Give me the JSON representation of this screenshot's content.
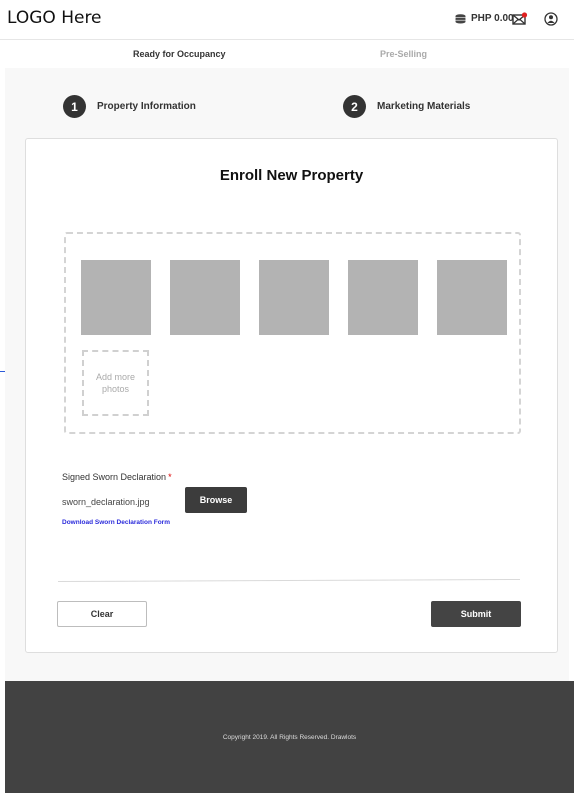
{
  "header": {
    "logo": "LOGO Here",
    "balance": "PHP 0.00",
    "icons": [
      "coins-icon",
      "mail-icon",
      "user-icon"
    ]
  },
  "tabs": [
    {
      "label": "Ready for Occupancy",
      "active": true
    },
    {
      "label": "Pre-Selling",
      "active": false
    }
  ],
  "steps": [
    {
      "number": "1",
      "label": "Property Information"
    },
    {
      "number": "2",
      "label": "Marketing Materials"
    }
  ],
  "form": {
    "title": "Enroll New Property",
    "add_more_label": "Add more photos",
    "sworn_label": "Signed Sworn Declaration",
    "required_mark": "*",
    "file_name": "sworn_declaration.jpg",
    "browse_label": "Browse",
    "download_link": "Download Sworn Declaration Form",
    "clear_label": "Clear",
    "submit_label": "Submit"
  },
  "footer": {
    "copyright": "Copyright 2019. All Rights Reserved. Drawlots"
  },
  "colors": {
    "dark": "#424242",
    "photo_placeholder": "#b3b3b3",
    "link": "#2a2adb",
    "notification": "#e02020"
  }
}
